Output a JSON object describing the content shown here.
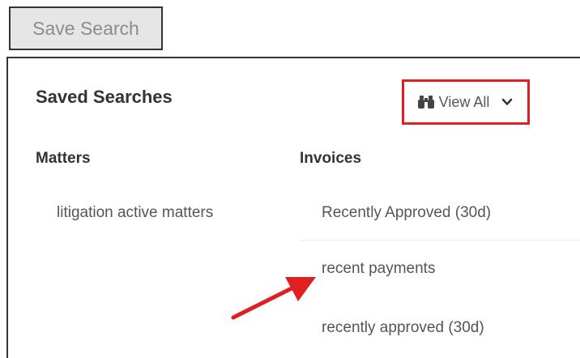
{
  "toolbar": {
    "save_search_label": "Save Search"
  },
  "panel": {
    "title": "Saved Searches",
    "view_all_label": "View All",
    "columns": {
      "matters": {
        "header": "Matters",
        "items": [
          "litigation active matters"
        ]
      },
      "invoices": {
        "header": "Invoices",
        "items": [
          "Recently Approved (30d)",
          "recent payments",
          "recently approved (30d)"
        ]
      }
    }
  },
  "colors": {
    "highlight_border": "#e02020",
    "annotation_arrow": "#e02020",
    "text_primary": "#333333",
    "text_secondary": "#555555",
    "button_bg": "#e6e6e6"
  },
  "icons": {
    "view_all": "binoculars-icon",
    "dropdown": "chevron-down-icon",
    "annotation": "arrow-icon"
  }
}
